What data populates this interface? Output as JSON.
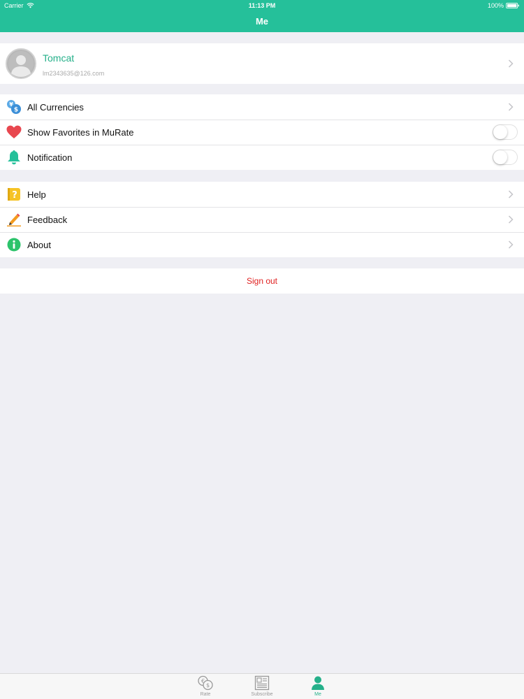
{
  "status_bar": {
    "carrier": "Carrier",
    "time": "11:13 PM",
    "battery": "100%"
  },
  "nav": {
    "title": "Me"
  },
  "profile": {
    "name": "Tomcat",
    "email": "lm2343635@126.com",
    "avatar_icon": "user-avatar-icon"
  },
  "settings_group": [
    {
      "label": "All Currencies",
      "icon": "currency-exchange-icon",
      "accessory": "chevron"
    },
    {
      "label": "Show Favorites in MuRate",
      "icon": "heart-icon",
      "accessory": "toggle",
      "on": false
    },
    {
      "label": "Notification",
      "icon": "bell-icon",
      "accessory": "toggle",
      "on": false
    }
  ],
  "info_group": [
    {
      "label": "Help",
      "icon": "help-icon",
      "accessory": "chevron"
    },
    {
      "label": "Feedback",
      "icon": "pencil-icon",
      "accessory": "chevron"
    },
    {
      "label": "About",
      "icon": "info-icon",
      "accessory": "chevron"
    }
  ],
  "sign_out": {
    "label": "Sign out"
  },
  "tabbar": {
    "tabs": [
      {
        "label": "Rate",
        "icon": "currency-rate-icon",
        "active": false
      },
      {
        "label": "Subscribe",
        "icon": "newspaper-icon",
        "active": false
      },
      {
        "label": "Me",
        "icon": "person-icon",
        "active": true
      }
    ]
  },
  "colors": {
    "accent": "#25c09a",
    "accent_text": "#25b08a",
    "danger": "#e02020",
    "background": "#efeff4"
  }
}
